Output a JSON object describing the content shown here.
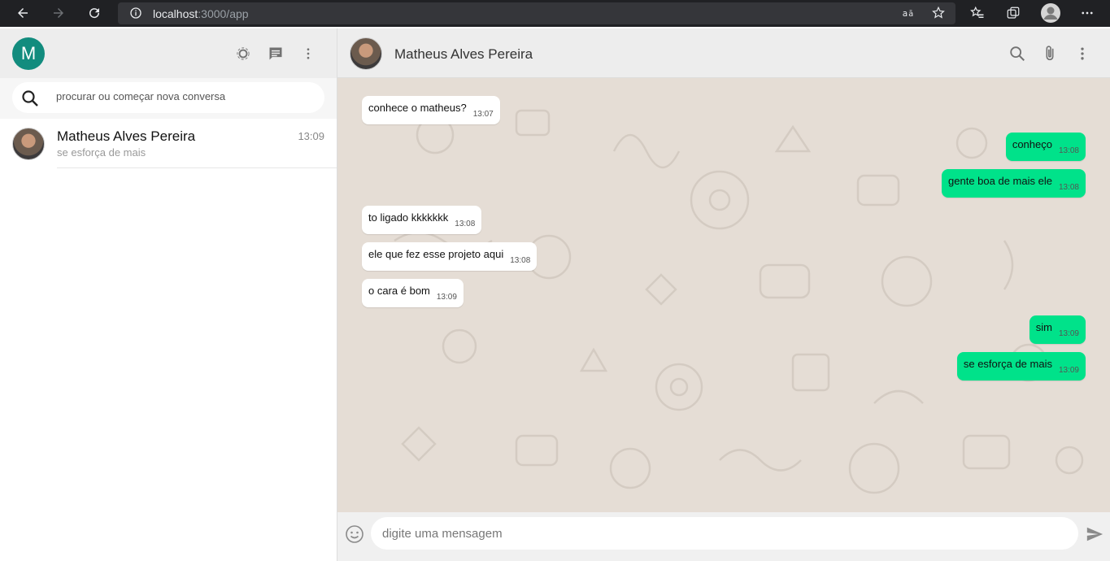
{
  "browser": {
    "url_host": "localhost",
    "url_path": ":3000/app"
  },
  "sidebar": {
    "profile_initial": "M",
    "icons": [
      "status-icon",
      "new-chat-icon",
      "menu-icon"
    ],
    "search": {
      "placeholder": "procurar ou começar nova conversa",
      "value": ""
    },
    "chats": [
      {
        "name": "Matheus Alves Pereira",
        "time": "13:09",
        "preview": "se esforça de mais"
      }
    ]
  },
  "main": {
    "contact_name": "Matheus Alves Pereira",
    "icons": [
      "search-icon",
      "attach-icon",
      "menu-icon"
    ],
    "messages": [
      {
        "direction": "in",
        "text": "conhece o matheus?",
        "time": "13:07"
      },
      {
        "direction": "out",
        "text": "conheço",
        "time": "13:08"
      },
      {
        "direction": "out",
        "text": "gente boa de mais ele",
        "time": "13:08"
      },
      {
        "direction": "in",
        "text": "to ligado kkkkkkk",
        "time": "13:08"
      },
      {
        "direction": "in",
        "text": "ele que fez esse projeto aqui",
        "time": "13:08"
      },
      {
        "direction": "in",
        "text": "o cara é bom",
        "time": "13:09"
      },
      {
        "direction": "out",
        "text": "sim",
        "time": "13:09"
      },
      {
        "direction": "out",
        "text": "se esforça de mais",
        "time": "13:09"
      }
    ],
    "input": {
      "placeholder": "digite uma mensagem",
      "value": ""
    }
  },
  "colors": {
    "incoming_bubble": "#ffffff",
    "outgoing_bubble": "#00e28a",
    "chat_background": "#e5ddd5",
    "avatar_accent": "#128c7e"
  }
}
